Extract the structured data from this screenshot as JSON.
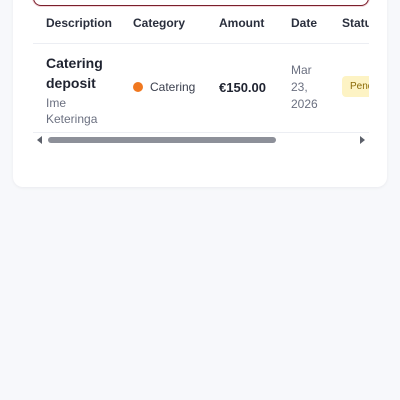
{
  "table": {
    "headers": [
      "Description",
      "Category",
      "Amount",
      "Date",
      "Status"
    ],
    "rows": [
      {
        "description": "Catering deposit",
        "subtitle": "Ime Keteringa",
        "category": "Catering",
        "category_color": "#f07820",
        "amount": "€150.00",
        "date": "Mar 23, 2026",
        "status": "Pending"
      }
    ]
  },
  "colors": {
    "accent_border": "#7a1f2b",
    "pending_bg": "#fdf3c4",
    "pending_text": "#8a6a08"
  }
}
